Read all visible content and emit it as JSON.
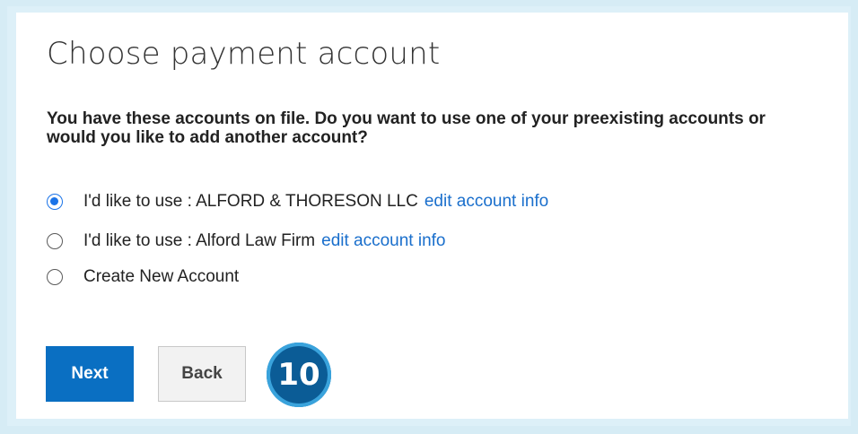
{
  "page": {
    "title": "Choose payment account",
    "prompt": "You have these accounts on file. Do you want to use one of your preexisting accounts or would you like to add another account?"
  },
  "options": [
    {
      "label": "I'd like to use : ALFORD & THORESON LLC",
      "link": "edit account info",
      "checked": true
    },
    {
      "label": "I'd like to use : Alford Law Firm",
      "link": "edit account info",
      "checked": false
    },
    {
      "label": "Create New Account",
      "link": "",
      "checked": false
    }
  ],
  "buttons": {
    "next_label": "Next",
    "back_label": "Back"
  },
  "step_badge": "10",
  "colors": {
    "primary": "#0a6fc2",
    "link": "#1a6fcc",
    "badge": "#0b5c96"
  }
}
